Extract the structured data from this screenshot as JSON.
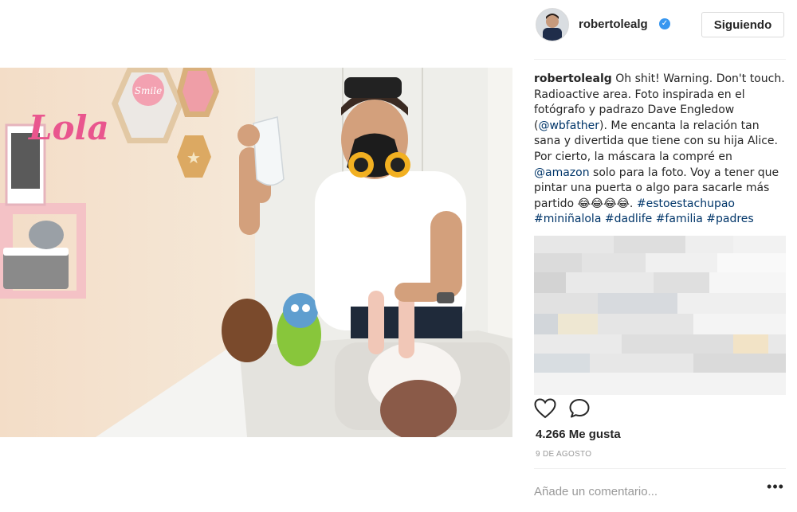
{
  "post": {
    "username": "robertolealg",
    "follow_label": "Siguiendo",
    "caption": {
      "username": "robertolealg",
      "text_1": " Oh shit! Warning. Don't touch. Radioactive area. Foto inspirada en el fotógrafo y padrazo Dave Engledow (",
      "mention_1": "@wbfather",
      "text_2": "). Me encanta la relación tan sana y divertida que tiene con su hija Alice. Por cierto, la máscara la compré en ",
      "mention_2": "@amazon",
      "text_3": " solo para la foto. Voy a tener que pintar una puerta o algo para sacarle más partido 😂😂😂😂. ",
      "hashtags": "#estoestachupao #miniñalola #dadlife #familia #padres"
    },
    "photo": {
      "wall_name": "Lola",
      "sign_text": "Smile"
    },
    "likes": "4.266 Me gusta",
    "date": "9 DE AGOSTO",
    "comment_placeholder": "Añade un comentario...",
    "more_label": "•••"
  },
  "icons": {
    "verified": "verified-badge-icon",
    "like": "heart-icon",
    "comment": "speech-bubble-icon",
    "more": "more-options-icon"
  },
  "colors": {
    "link": "#003569",
    "verified": "#3897f0",
    "muted": "#999999",
    "text": "#262626"
  }
}
